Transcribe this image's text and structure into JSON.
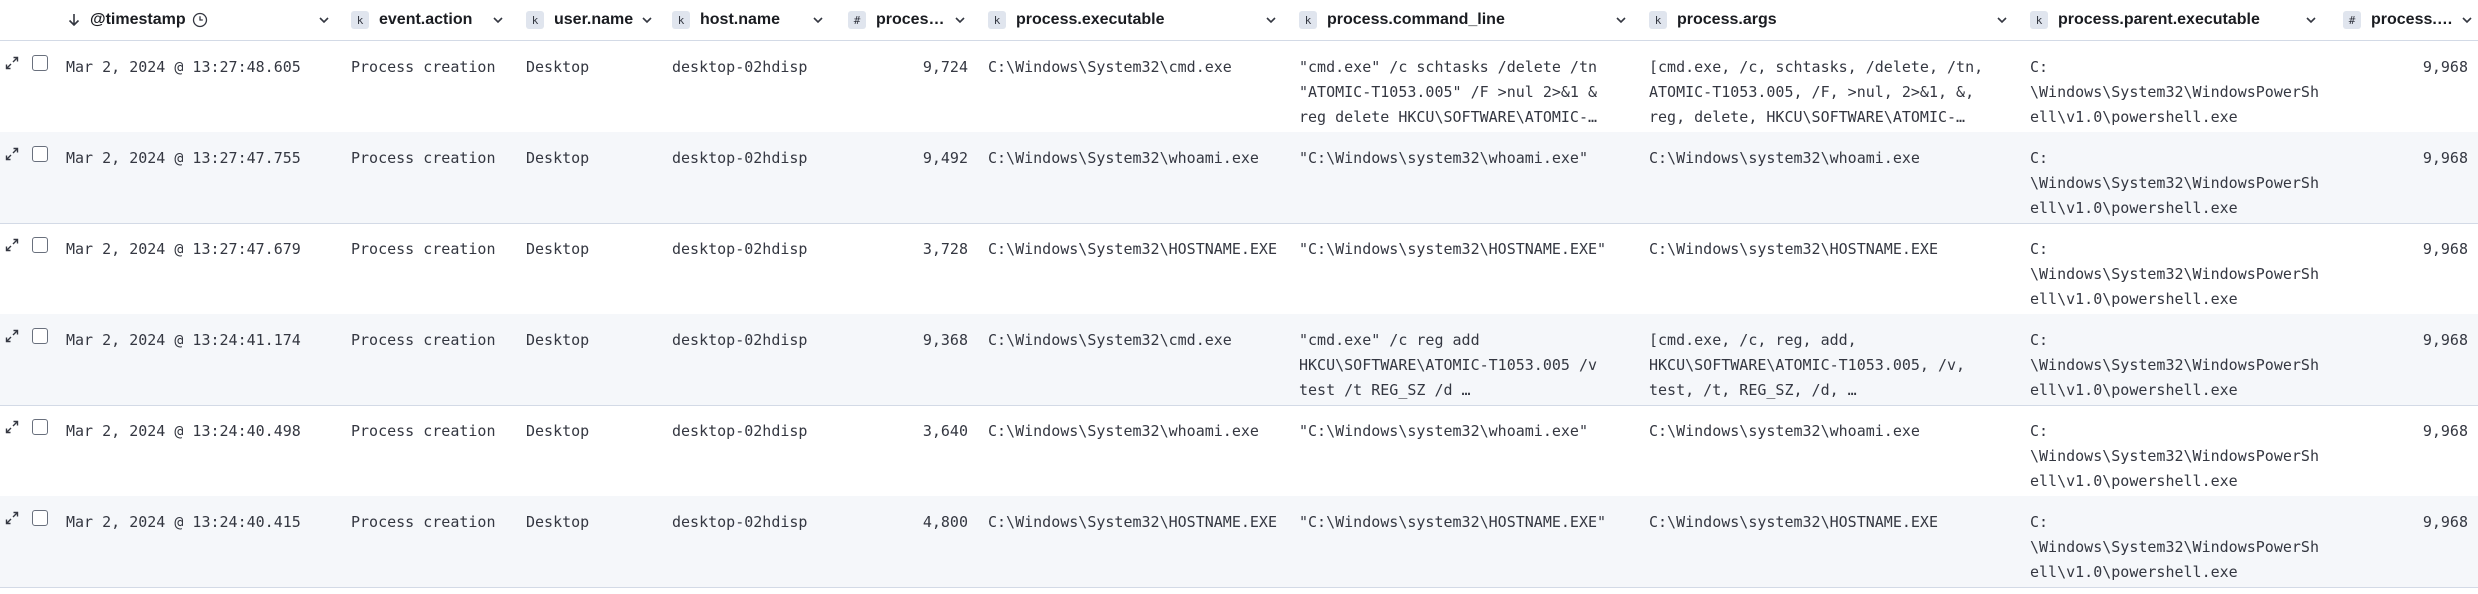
{
  "columns": [
    {
      "label": "@timestamp",
      "type": ""
    },
    {
      "label": "event.action",
      "type": "k"
    },
    {
      "label": "user.name",
      "type": "k"
    },
    {
      "label": "host.name",
      "type": "k"
    },
    {
      "label": "process.…",
      "type": "#"
    },
    {
      "label": "process.executable",
      "type": "k"
    },
    {
      "label": "process.command_line",
      "type": "k"
    },
    {
      "label": "process.args",
      "type": "k"
    },
    {
      "label": "process.parent.executable",
      "type": "k"
    },
    {
      "label": "process.p…",
      "type": "#"
    }
  ],
  "rows": [
    {
      "timestamp": "Mar 2, 2024 @ 13:27:48.605",
      "action": "Process creation",
      "user": "Desktop",
      "host": "desktop-02hdisp",
      "pid": "9,724",
      "exe": "C:\\Windows\\System32\\cmd.exe",
      "cmd": "\"cmd.exe\" /c schtasks /delete /tn\n\"ATOMIC-T1053.005\" /F >nul 2>&1 &\nreg delete HKCU\\SOFTWARE\\ATOMIC-…",
      "args": "[cmd.exe, /c, schtasks, /delete, /tn,\nATOMIC-T1053.005, /F, >nul, 2>&1, &,\nreg, delete, HKCU\\SOFTWARE\\ATOMIC-…",
      "parent": "C:\n\\Windows\\System32\\WindowsPowerSh\nell\\v1.0\\powershell.exe",
      "ppid": "9,968"
    },
    {
      "timestamp": "Mar 2, 2024 @ 13:27:47.755",
      "action": "Process creation",
      "user": "Desktop",
      "host": "desktop-02hdisp",
      "pid": "9,492",
      "exe": "C:\\Windows\\System32\\whoami.exe",
      "cmd": "\"C:\\Windows\\system32\\whoami.exe\"",
      "args": "C:\\Windows\\system32\\whoami.exe",
      "parent": "C:\n\\Windows\\System32\\WindowsPowerSh\nell\\v1.0\\powershell.exe",
      "ppid": "9,968"
    },
    {
      "timestamp": "Mar 2, 2024 @ 13:27:47.679",
      "action": "Process creation",
      "user": "Desktop",
      "host": "desktop-02hdisp",
      "pid": "3,728",
      "exe": "C:\\Windows\\System32\\HOSTNAME.EXE",
      "cmd": "\"C:\\Windows\\system32\\HOSTNAME.EXE\"",
      "args": "C:\\Windows\\system32\\HOSTNAME.EXE",
      "parent": "C:\n\\Windows\\System32\\WindowsPowerSh\nell\\v1.0\\powershell.exe",
      "ppid": "9,968"
    },
    {
      "timestamp": "Mar 2, 2024 @ 13:24:41.174",
      "action": "Process creation",
      "user": "Desktop",
      "host": "desktop-02hdisp",
      "pid": "9,368",
      "exe": "C:\\Windows\\System32\\cmd.exe",
      "cmd": "\"cmd.exe\" /c reg add\nHKCU\\SOFTWARE\\ATOMIC-T1053.005 /v\ntest /t REG_SZ /d …",
      "args": "[cmd.exe, /c, reg, add,\nHKCU\\SOFTWARE\\ATOMIC-T1053.005, /v,\ntest, /t, REG_SZ, /d, …",
      "parent": "C:\n\\Windows\\System32\\WindowsPowerSh\nell\\v1.0\\powershell.exe",
      "ppid": "9,968"
    },
    {
      "timestamp": "Mar 2, 2024 @ 13:24:40.498",
      "action": "Process creation",
      "user": "Desktop",
      "host": "desktop-02hdisp",
      "pid": "3,640",
      "exe": "C:\\Windows\\System32\\whoami.exe",
      "cmd": "\"C:\\Windows\\system32\\whoami.exe\"",
      "args": "C:\\Windows\\system32\\whoami.exe",
      "parent": "C:\n\\Windows\\System32\\WindowsPowerSh\nell\\v1.0\\powershell.exe",
      "ppid": "9,968"
    },
    {
      "timestamp": "Mar 2, 2024 @ 13:24:40.415",
      "action": "Process creation",
      "user": "Desktop",
      "host": "desktop-02hdisp",
      "pid": "4,800",
      "exe": "C:\\Windows\\System32\\HOSTNAME.EXE",
      "cmd": "\"C:\\Windows\\system32\\HOSTNAME.EXE\"",
      "args": "C:\\Windows\\system32\\HOSTNAME.EXE",
      "parent": "C:\n\\Windows\\System32\\WindowsPowerSh\nell\\v1.0\\powershell.exe",
      "ppid": "9,968"
    }
  ],
  "icons": {
    "sort": "arrow-down-icon",
    "clock": "clock-icon",
    "chevron": "chevron-down-icon",
    "expand": "expand-icon"
  },
  "colors": {
    "border": "#d3dae6",
    "row_alt": "#f5f7fa",
    "badge": "#e0e5ee",
    "text": "#343741"
  }
}
